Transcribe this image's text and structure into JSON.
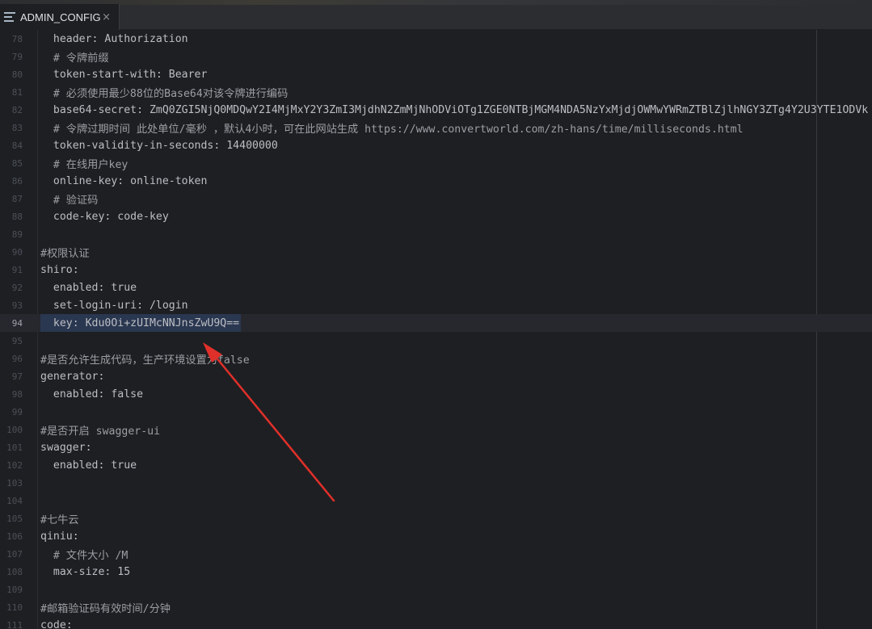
{
  "tab": {
    "title": "ADMIN_CONFIG",
    "close": "×"
  },
  "lines": [
    {
      "num": "78",
      "text": "  header: Authorization"
    },
    {
      "num": "79",
      "text": "  # 令牌前缀"
    },
    {
      "num": "80",
      "text": "  token-start-with: Bearer"
    },
    {
      "num": "81",
      "text": "  # 必须使用最少88位的Base64对该令牌进行编码"
    },
    {
      "num": "82",
      "text": "  base64-secret: ZmQ0ZGI5NjQ0MDQwY2I4MjMxY2Y3ZmI3MjdhN2ZmMjNhODViOTg1ZGE0NTBjMGM4NDA5NzYxMjdjOWMwYWRmZTBlZjlhNGY3ZTg4Y2U3YTE1ODVk"
    },
    {
      "num": "83",
      "text": "  # 令牌过期时间 此处单位/毫秒 ，默认4小时，可在此网站生成 https://www.convertworld.com/zh-hans/time/milliseconds.html"
    },
    {
      "num": "84",
      "text": "  token-validity-in-seconds: 14400000"
    },
    {
      "num": "85",
      "text": "  # 在线用户key"
    },
    {
      "num": "86",
      "text": "  online-key: online-token"
    },
    {
      "num": "87",
      "text": "  # 验证码"
    },
    {
      "num": "88",
      "text": "  code-key: code-key"
    },
    {
      "num": "89",
      "text": ""
    },
    {
      "num": "90",
      "text": "#权限认证"
    },
    {
      "num": "91",
      "text": "shiro:"
    },
    {
      "num": "92",
      "text": "  enabled: true"
    },
    {
      "num": "93",
      "text": "  set-login-uri: /login"
    },
    {
      "num": "94",
      "text": "  key: Kdu0Oi+zUIMcNNJnsZwU9Q=="
    },
    {
      "num": "95",
      "text": ""
    },
    {
      "num": "96",
      "text": "#是否允许生成代码，生产环境设置为false"
    },
    {
      "num": "97",
      "text": "generator:"
    },
    {
      "num": "98",
      "text": "  enabled: false"
    },
    {
      "num": "99",
      "text": ""
    },
    {
      "num": "100",
      "text": "#是否开启 swagger-ui"
    },
    {
      "num": "101",
      "text": "swagger:"
    },
    {
      "num": "102",
      "text": "  enabled: true"
    },
    {
      "num": "103",
      "text": ""
    },
    {
      "num": "104",
      "text": ""
    },
    {
      "num": "105",
      "text": "#七牛云"
    },
    {
      "num": "106",
      "text": "qiniu:"
    },
    {
      "num": "107",
      "text": "  # 文件大小 /M"
    },
    {
      "num": "108",
      "text": "  max-size: 15"
    },
    {
      "num": "109",
      "text": ""
    },
    {
      "num": "110",
      "text": "#邮箱验证码有效时间/分钟"
    },
    {
      "num": "111",
      "text": "code:"
    }
  ],
  "colors": {
    "arrow": "#e0302a",
    "background": "#1e1f22"
  }
}
